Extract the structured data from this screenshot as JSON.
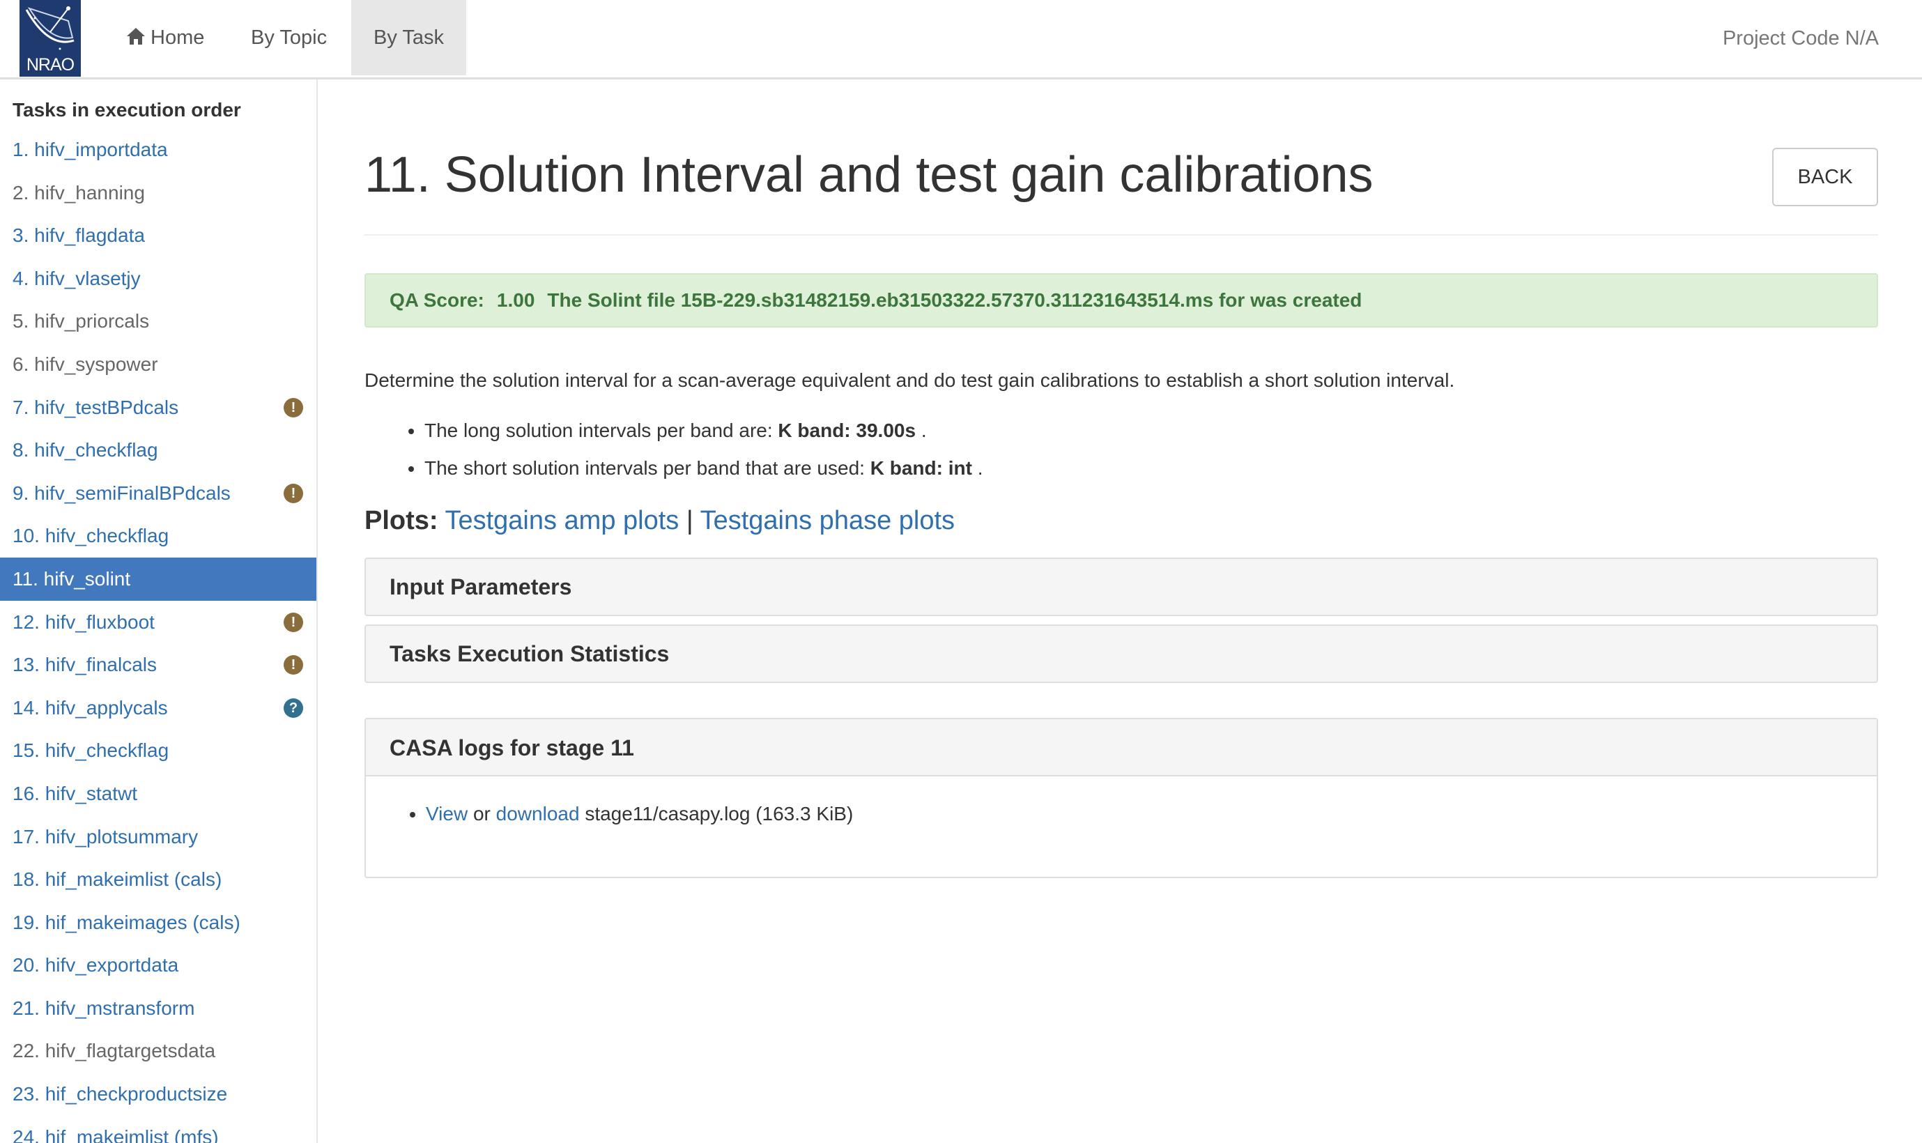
{
  "navbar": {
    "logo_text": "NRAO",
    "home_label": "Home",
    "by_topic_label": "By Topic",
    "by_task_label": "By Task",
    "project_code": "Project Code N/A"
  },
  "sidebar": {
    "title": "Tasks in execution order",
    "items": [
      {
        "label": "1. hifv_importdata",
        "state": "link",
        "badge": ""
      },
      {
        "label": "2. hifv_hanning",
        "state": "muted",
        "badge": ""
      },
      {
        "label": "3. hifv_flagdata",
        "state": "link",
        "badge": ""
      },
      {
        "label": "4. hifv_vlasetjy",
        "state": "link",
        "badge": ""
      },
      {
        "label": "5. hifv_priorcals",
        "state": "muted",
        "badge": ""
      },
      {
        "label": "6. hifv_syspower",
        "state": "muted",
        "badge": ""
      },
      {
        "label": "7. hifv_testBPdcals",
        "state": "link",
        "badge": "warning"
      },
      {
        "label": "8. hifv_checkflag",
        "state": "link",
        "badge": ""
      },
      {
        "label": "9. hifv_semiFinalBPdcals",
        "state": "link",
        "badge": "warning"
      },
      {
        "label": "10. hifv_checkflag",
        "state": "link",
        "badge": ""
      },
      {
        "label": "11. hifv_solint",
        "state": "active",
        "badge": ""
      },
      {
        "label": "12. hifv_fluxboot",
        "state": "link",
        "badge": "warning"
      },
      {
        "label": "13. hifv_finalcals",
        "state": "link",
        "badge": "warning"
      },
      {
        "label": "14. hifv_applycals",
        "state": "link",
        "badge": "question"
      },
      {
        "label": "15. hifv_checkflag",
        "state": "link",
        "badge": ""
      },
      {
        "label": "16. hifv_statwt",
        "state": "link",
        "badge": ""
      },
      {
        "label": "17. hifv_plotsummary",
        "state": "link",
        "badge": ""
      },
      {
        "label": "18. hif_makeimlist (cals)",
        "state": "link",
        "badge": ""
      },
      {
        "label": "19. hif_makeimages (cals)",
        "state": "link",
        "badge": ""
      },
      {
        "label": "20. hifv_exportdata",
        "state": "link",
        "badge": ""
      },
      {
        "label": "21. hifv_mstransform",
        "state": "link",
        "badge": ""
      },
      {
        "label": "22. hifv_flagtargetsdata",
        "state": "muted",
        "badge": ""
      },
      {
        "label": "23. hif_checkproductsize",
        "state": "link",
        "badge": ""
      },
      {
        "label": "24. hif_makeimlist (mfs)",
        "state": "link",
        "badge": ""
      }
    ]
  },
  "main": {
    "title": "11. Solution Interval and test gain calibrations",
    "back_label": "BACK",
    "qa": {
      "label": "QA Score:",
      "value": "1.00",
      "message": "The Solint file 15B-229.sb31482159.eb31503322.57370.311231643514.ms for was created"
    },
    "description": "Determine the solution interval for a scan-average equivalent and do test gain calibrations to establish a short solution interval.",
    "bullets": [
      {
        "text": "The long solution intervals per band are:",
        "bold": "K band: 39.00s",
        "tail": "."
      },
      {
        "text": "The short solution intervals per band that are used:",
        "bold": "K band: int",
        "tail": "."
      }
    ],
    "plots": {
      "label": "Plots:",
      "amp_link": "Testgains amp plots",
      "separator": "|",
      "phase_link": "Testgains phase plots"
    },
    "panels": {
      "input_parameters": "Input Parameters",
      "execution_stats": "Tasks Execution Statistics",
      "casa_logs": "CASA logs for stage 11"
    },
    "log": {
      "view_link": "View",
      "or_text": "or",
      "download_link": "download",
      "file": "stage11/casapy.log (163.3 KiB)"
    }
  },
  "colors": {
    "link": "#2f6fb0",
    "active_bg": "#4279be",
    "qa_bg": "#dff0d8",
    "qa_text": "#3c763d",
    "warning_badge": "#8a6d3b",
    "info_badge": "#31708f",
    "logo_bg": "#1f3a6e"
  },
  "icons": {
    "home": "home-icon",
    "warning": "exclamation-circle-icon",
    "question": "question-circle-icon"
  }
}
